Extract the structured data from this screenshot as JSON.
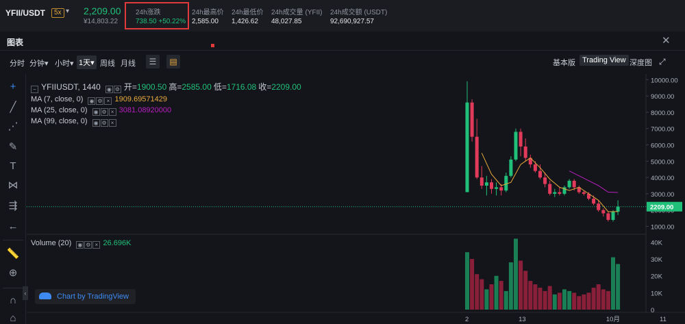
{
  "ticker": {
    "pair": "YFII/USDT",
    "leverage": "5x",
    "last_price": "2,209.00",
    "cny_price": "¥14,803.22",
    "stats": [
      {
        "label": "24h涨跌",
        "value": "738.50 +50.22%"
      },
      {
        "label": "24h最高价",
        "value": "2,585.00"
      },
      {
        "label": "24h最低价",
        "value": "1,426.62"
      },
      {
        "label": "24h成交量 (YFII)",
        "value": "48,027.85"
      },
      {
        "label": "24h成交额 (USDT)",
        "value": "92,690,927.57"
      }
    ]
  },
  "chart_panel": {
    "title": "图表"
  },
  "toolbar": {
    "timeframes": [
      "分时",
      "分钟▾",
      "小时▾",
      "1天▾",
      "周线",
      "月线"
    ],
    "active_timeframe": "1天▾",
    "views": [
      "基本版",
      "Trading View",
      "深度图"
    ],
    "active_view": "Trading View"
  },
  "legend": {
    "symbol": "YFIIUSDT, 1440",
    "open_label": "开=",
    "open": "1900.50",
    "high_label": "高=",
    "high": "2585.00",
    "low_label": "低=",
    "low": "1716.08",
    "close_label": "收=",
    "close": "2209.00",
    "ma7_label": "MA (7, close, 0)",
    "ma7_value": "1909.69571429",
    "ma25_label": "MA (25, close, 0)",
    "ma25_value": "3081.08920000",
    "ma99_label": "MA (99, close, 0)",
    "volume_label": "Volume (20)",
    "volume_value": "26.696K"
  },
  "brand": "Chart by TradingView",
  "colors": {
    "up": "#20c07a",
    "down": "#e23a5a",
    "ma7": "#e7a93d",
    "ma25": "#b81ec0"
  },
  "chart_data": {
    "type": "candlestick",
    "price_axis_ticks": [
      "10000.00",
      "9000.00",
      "8000.00",
      "7000.00",
      "6000.00",
      "5000.00",
      "4000.00",
      "3000.00",
      "2000.00",
      "1000.00"
    ],
    "price_range": [
      600,
      10350
    ],
    "current_price_label": "2209.00",
    "current_price": 2209,
    "volume_axis_ticks": [
      "40K",
      "30K",
      "20K",
      "10K",
      "0"
    ],
    "volume_range": [
      0,
      43000
    ],
    "x_ticks": [
      "2",
      "13",
      "10月",
      "11"
    ],
    "x_tick_index": [
      0,
      11,
      29,
      40
    ],
    "candles": [
      {
        "o": 3100,
        "h": 9900,
        "l": 3100,
        "c": 8600,
        "v": 34000
      },
      {
        "o": 8600,
        "h": 8800,
        "l": 6200,
        "c": 6500,
        "v": 30000
      },
      {
        "o": 6500,
        "h": 7600,
        "l": 3900,
        "c": 4000,
        "v": 21000
      },
      {
        "o": 4000,
        "h": 4700,
        "l": 3300,
        "c": 3500,
        "v": 18000
      },
      {
        "o": 3500,
        "h": 4100,
        "l": 2900,
        "c": 3700,
        "v": 12000
      },
      {
        "o": 3700,
        "h": 3900,
        "l": 3000,
        "c": 3300,
        "v": 15000
      },
      {
        "o": 3300,
        "h": 3700,
        "l": 2900,
        "c": 3400,
        "v": 20000
      },
      {
        "o": 3400,
        "h": 3600,
        "l": 2900,
        "c": 3200,
        "v": 17000
      },
      {
        "o": 3200,
        "h": 4300,
        "l": 3100,
        "c": 4100,
        "v": 11000
      },
      {
        "o": 4100,
        "h": 5300,
        "l": 4000,
        "c": 5100,
        "v": 28000
      },
      {
        "o": 5100,
        "h": 7000,
        "l": 5000,
        "c": 6800,
        "v": 42000
      },
      {
        "o": 6800,
        "h": 7000,
        "l": 5300,
        "c": 5900,
        "v": 29000
      },
      {
        "o": 5900,
        "h": 6400,
        "l": 5000,
        "c": 5200,
        "v": 23000
      },
      {
        "o": 5200,
        "h": 5400,
        "l": 4600,
        "c": 4800,
        "v": 17000
      },
      {
        "o": 4800,
        "h": 5000,
        "l": 4300,
        "c": 4400,
        "v": 15000
      },
      {
        "o": 4400,
        "h": 4800,
        "l": 3900,
        "c": 4000,
        "v": 13000
      },
      {
        "o": 4000,
        "h": 4300,
        "l": 3400,
        "c": 3600,
        "v": 11000
      },
      {
        "o": 3600,
        "h": 3800,
        "l": 2900,
        "c": 3000,
        "v": 14000
      },
      {
        "o": 3000,
        "h": 3300,
        "l": 2800,
        "c": 3100,
        "v": 9000
      },
      {
        "o": 3100,
        "h": 3400,
        "l": 2900,
        "c": 3000,
        "v": 10000
      },
      {
        "o": 3000,
        "h": 3500,
        "l": 2900,
        "c": 3400,
        "v": 12000
      },
      {
        "o": 3400,
        "h": 3900,
        "l": 3300,
        "c": 3800,
        "v": 11000
      },
      {
        "o": 3800,
        "h": 3900,
        "l": 3200,
        "c": 3400,
        "v": 10000
      },
      {
        "o": 3400,
        "h": 3500,
        "l": 3000,
        "c": 3100,
        "v": 8000
      },
      {
        "o": 3100,
        "h": 3200,
        "l": 2900,
        "c": 3000,
        "v": 9000
      },
      {
        "o": 3000,
        "h": 3100,
        "l": 2600,
        "c": 2700,
        "v": 10000
      },
      {
        "o": 2700,
        "h": 2900,
        "l": 2300,
        "c": 2400,
        "v": 13000
      },
      {
        "o": 2400,
        "h": 2600,
        "l": 1900,
        "c": 2000,
        "v": 15000
      },
      {
        "o": 2000,
        "h": 2100,
        "l": 1600,
        "c": 1800,
        "v": 12000
      },
      {
        "o": 1800,
        "h": 1900,
        "l": 1300,
        "c": 1400,
        "v": 11000
      },
      {
        "o": 1400,
        "h": 2000,
        "l": 1300,
        "c": 1900,
        "v": 31000
      },
      {
        "o": 1900,
        "h": 2600,
        "l": 1700,
        "c": 2209,
        "v": 27000
      }
    ],
    "ma7": [
      [
        3,
        5500
      ],
      [
        5,
        4200
      ],
      [
        7,
        3500
      ],
      [
        9,
        3700
      ],
      [
        11,
        4800
      ],
      [
        13,
        5200
      ],
      [
        15,
        4600
      ],
      [
        17,
        3900
      ],
      [
        19,
        3400
      ],
      [
        21,
        3200
      ],
      [
        23,
        3400
      ],
      [
        25,
        3000
      ],
      [
        27,
        2600
      ],
      [
        29,
        1900
      ],
      [
        31,
        1909
      ]
    ],
    "ma25": [
      [
        21,
        4400
      ],
      [
        23,
        4100
      ],
      [
        25,
        3800
      ],
      [
        27,
        3500
      ],
      [
        29,
        3100
      ],
      [
        31,
        3081
      ]
    ]
  }
}
